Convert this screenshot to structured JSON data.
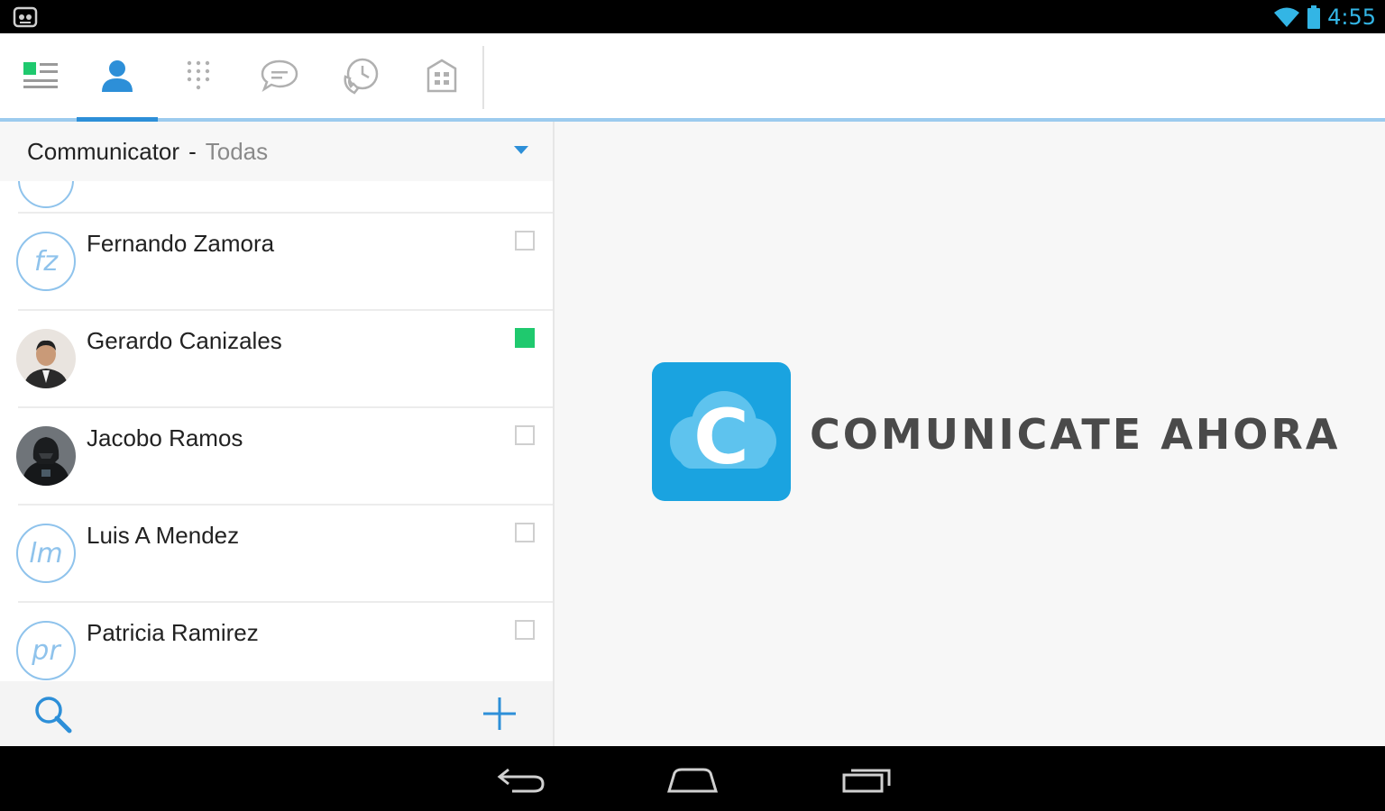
{
  "status_bar": {
    "time": "4:55",
    "icons": [
      "app-notification-icon",
      "wifi-icon",
      "battery-icon"
    ]
  },
  "toolbar": {
    "tabs": [
      {
        "name": "dashboard-icon",
        "active": false
      },
      {
        "name": "contacts-icon",
        "active": true
      },
      {
        "name": "dialpad-icon",
        "active": false
      },
      {
        "name": "chat-icon",
        "active": false
      },
      {
        "name": "call-history-icon",
        "active": false
      },
      {
        "name": "directory-icon",
        "active": false
      }
    ]
  },
  "list_header": {
    "title": "Communicator",
    "separator": "-",
    "filter": "Todas"
  },
  "contacts": [
    {
      "name": "Fernando Zamora",
      "initials": "fz",
      "avatar": "initials",
      "selected": false
    },
    {
      "name": "Gerardo Canizales",
      "initials": "",
      "avatar": "photo",
      "selected": true
    },
    {
      "name": "Jacobo Ramos",
      "initials": "",
      "avatar": "photo",
      "selected": false
    },
    {
      "name": "Luis A Mendez",
      "initials": "lm",
      "avatar": "initials",
      "selected": false
    },
    {
      "name": "Patricia Ramirez",
      "initials": "pr",
      "avatar": "initials",
      "selected": false
    }
  ],
  "brand": {
    "logo_letter": "C",
    "text": "COMUNICATE AHORA"
  },
  "colors": {
    "accent": "#2d8fd8",
    "selected": "#1fc96e",
    "logo": "#1aa3e0"
  },
  "navbar": {
    "buttons": [
      "back-icon",
      "home-icon",
      "recent-apps-icon"
    ]
  }
}
